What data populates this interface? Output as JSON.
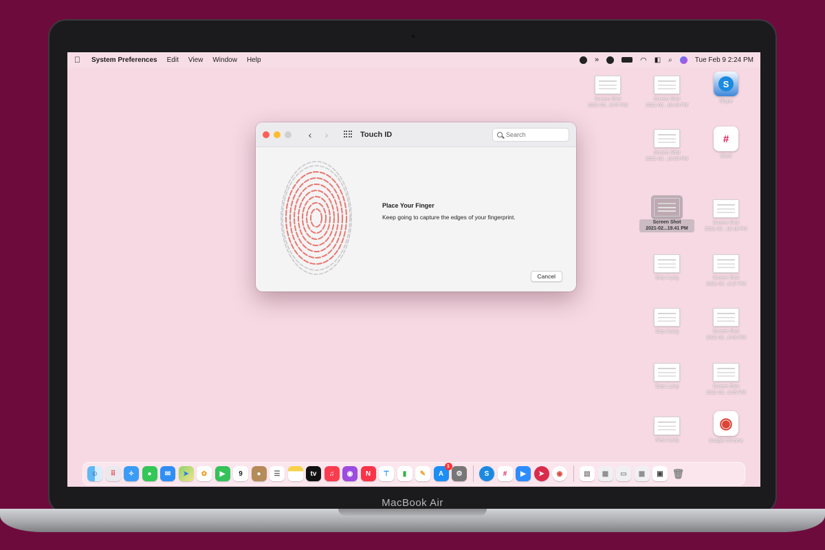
{
  "menubar": {
    "apple": "",
    "items": [
      "System Preferences",
      "Edit",
      "View",
      "Window",
      "Help"
    ],
    "clock": "Tue Feb 9  2:24 PM",
    "status_icons": [
      "camera-icon",
      "forward-icon",
      "shield-icon",
      "battery-icon",
      "wifi-icon",
      "controls-icon",
      "search-icon",
      "siri-icon"
    ]
  },
  "window": {
    "title": "Touch ID",
    "back_glyph": "‹",
    "forward_glyph": "›",
    "search_placeholder": "Search",
    "message_title": "Place Your Finger",
    "message_body": "Keep going to capture the edges of your fingerprint.",
    "cancel_label": "Cancel",
    "colors": {
      "fingerprint": "#e8776f",
      "traffic_red": "#fe5f57",
      "traffic_yellow": "#febc2e"
    }
  },
  "desktop": {
    "screenshot_icon_1": {
      "label": "Screen Shot\n2021-02...8.07 PM"
    },
    "screenshot_icon_2": {
      "label": "Screen Shot\n2021-02...18.48 PM"
    },
    "skype_icon": {
      "label": "Skype"
    },
    "screenshot_icon_3": {
      "label": "Screen Shot\n2021-02...19.03 PM"
    },
    "slack_icon": {
      "label": "Slack"
    },
    "screenshot_selected": {
      "label": "Screen Shot\n2021-02...19.41 PM"
    },
    "screenshot_icon_4": {
      "label": "Screen Shot\n2021-02...18.18 PM"
    },
    "step_icon_1": {
      "label": "Step 4.png"
    },
    "screenshot_icon_5": {
      "label": "Screen Shot\n2021-02...8.27 PM"
    },
    "step_icon_2": {
      "label": "Step 3.png"
    },
    "screenshot_icon_6": {
      "label": "Screen Shot\n2021-02...8.06 PM"
    },
    "step_icon_3": {
      "label": "Step 1.png"
    },
    "screenshot_icon_7": {
      "label": "Screen Shot\n2021-02...8.05 PM"
    },
    "step_icon_4": {
      "label": "Step 2.png"
    },
    "chrome_icon": {
      "label": "Google Chrome"
    },
    "skype_glyph": "S",
    "chrome_glyph": "◉",
    "slack_glyph": "#"
  },
  "dock": {
    "calendar_day": "9",
    "tv_label": "tv",
    "appstore_badge": "1",
    "apps": [
      "finder",
      "launchpad",
      "safari",
      "messages",
      "mail",
      "maps",
      "photos",
      "facetime",
      "calendar",
      "contacts",
      "reminders",
      "notes",
      "tv",
      "music",
      "podcasts",
      "news",
      "keynote",
      "numbers",
      "pages",
      "app-store",
      "system-preferences",
      "skype",
      "slack",
      "zoom",
      "airmail",
      "chrome",
      "downloads",
      "documents",
      "trash"
    ]
  },
  "device": {
    "brand_label": "MacBook Air"
  }
}
